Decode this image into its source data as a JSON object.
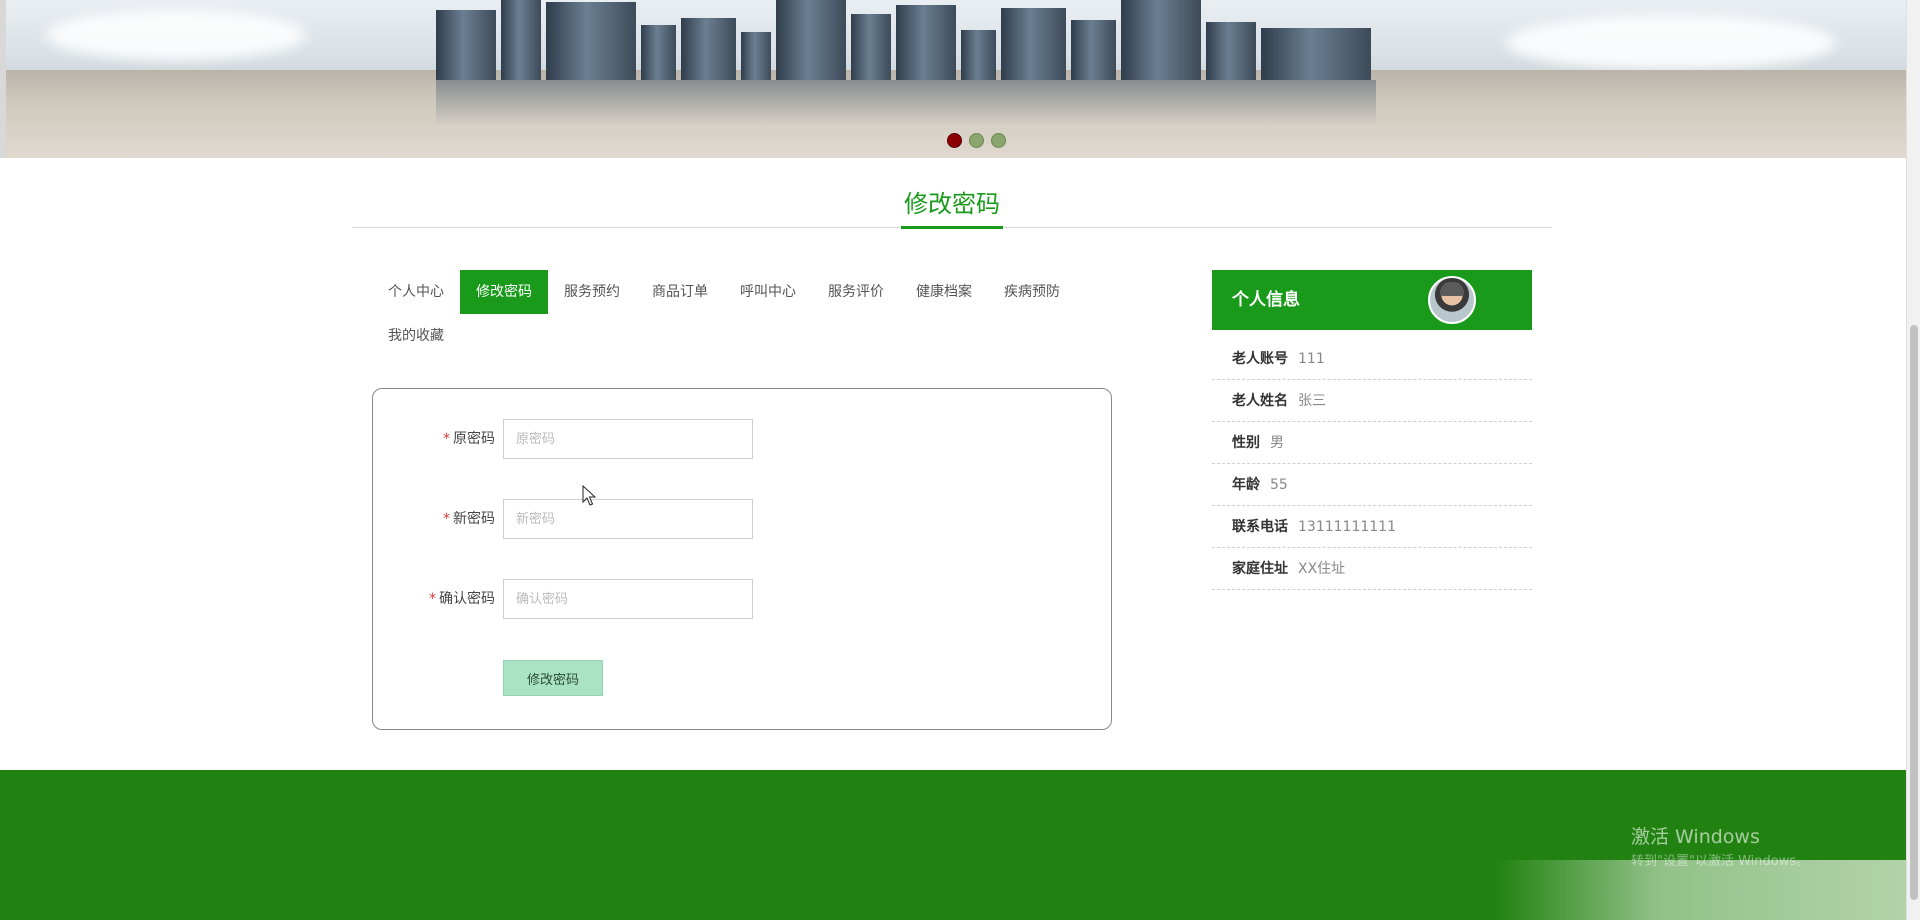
{
  "banner": {
    "slides": [
      {
        "active": true
      },
      {
        "active": false
      },
      {
        "active": false
      }
    ]
  },
  "section": {
    "title": "修改密码"
  },
  "tabs": [
    {
      "label": "个人中心",
      "active": false
    },
    {
      "label": "修改密码",
      "active": true
    },
    {
      "label": "服务预约",
      "active": false
    },
    {
      "label": "商品订单",
      "active": false
    },
    {
      "label": "呼叫中心",
      "active": false
    },
    {
      "label": "服务评价",
      "active": false
    },
    {
      "label": "健康档案",
      "active": false
    },
    {
      "label": "疾病预防",
      "active": false
    },
    {
      "label": "我的收藏",
      "active": false
    }
  ],
  "form": {
    "old_password": {
      "label": "原密码",
      "placeholder": "原密码",
      "value": ""
    },
    "new_password": {
      "label": "新密码",
      "placeholder": "新密码",
      "value": ""
    },
    "confirm_password": {
      "label": "确认密码",
      "placeholder": "确认密码",
      "value": ""
    },
    "required_mark": "*",
    "submit_label": "修改密码"
  },
  "profile": {
    "title": "个人信息",
    "fields": [
      {
        "key": "老人账号",
        "value": "111"
      },
      {
        "key": "老人姓名",
        "value": "张三"
      },
      {
        "key": "性别",
        "value": "男"
      },
      {
        "key": "年龄",
        "value": "55"
      },
      {
        "key": "联系电话",
        "value": "13111111111"
      },
      {
        "key": "家庭住址",
        "value": "XX住址"
      }
    ]
  },
  "watermark": {
    "title": "激活 Windows",
    "subtitle": "转到\"设置\"以激活 Windows。"
  },
  "colors": {
    "accent": "#1a9a1a",
    "footer": "#218211",
    "submit": "#a9e2c4",
    "required": "#e4393c"
  }
}
